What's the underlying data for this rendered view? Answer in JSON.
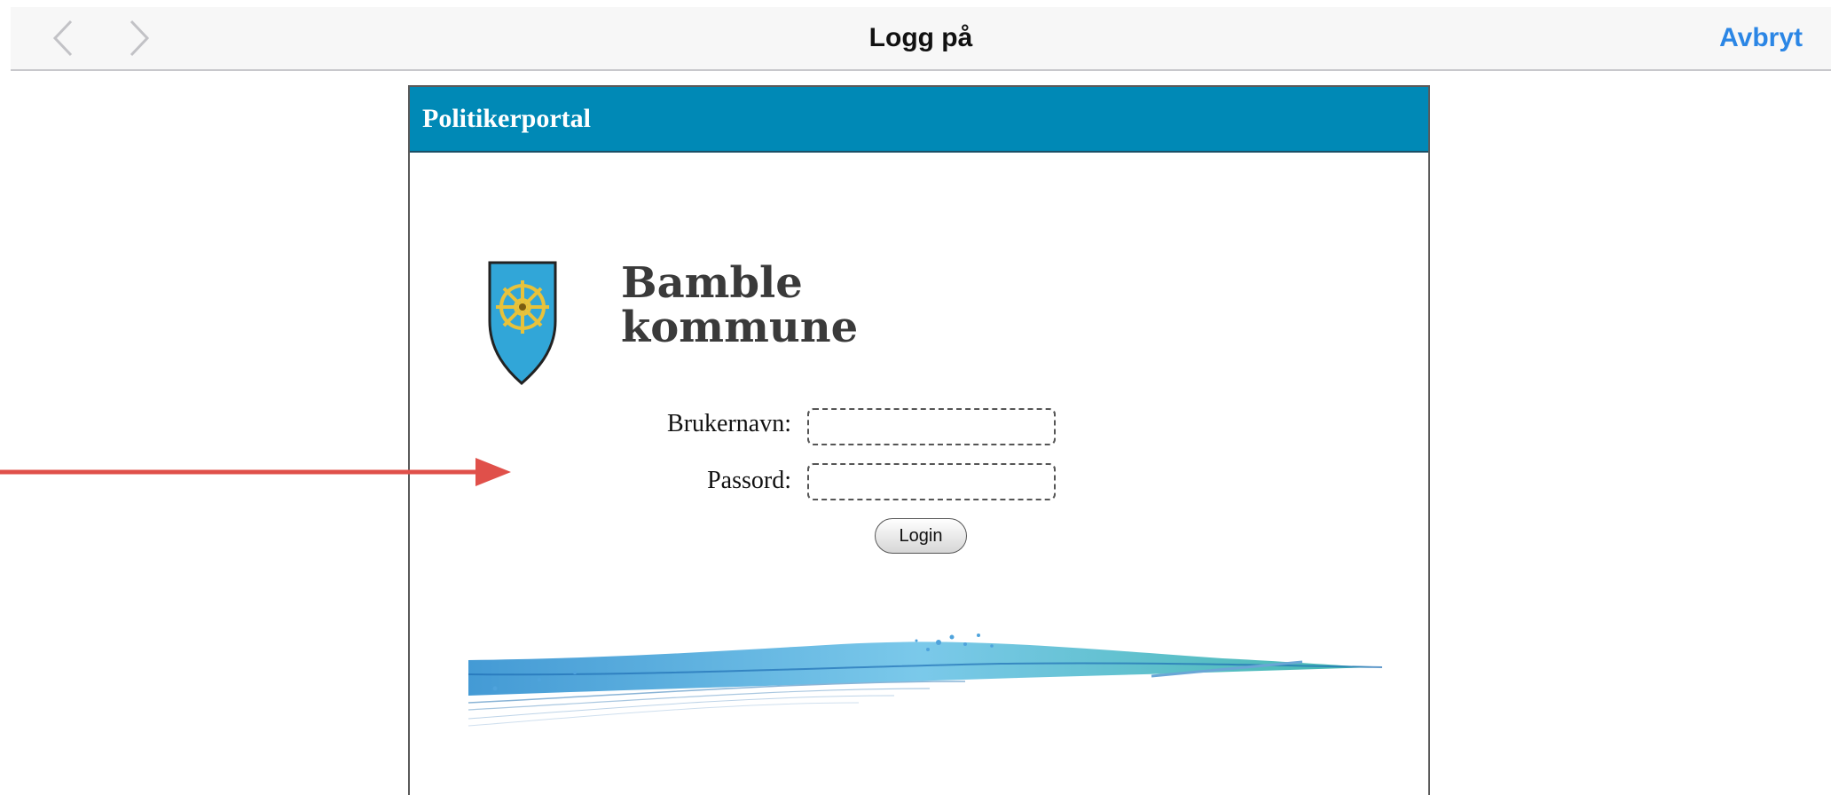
{
  "navbar": {
    "title": "Logg på",
    "cancel_label": "Avbryt",
    "back_icon": "chevron-left-icon",
    "forward_icon": "chevron-right-icon"
  },
  "portal": {
    "header_title": "Politikerportal",
    "brand_line1": "Bamble",
    "brand_line2": "kommune",
    "crest_icon": "ship-wheel-crest-icon",
    "accent_color": "#0089b6"
  },
  "form": {
    "username_label": "Brukernavn:",
    "username_value": "",
    "password_label": "Passord:",
    "password_value": "",
    "login_label": "Login"
  },
  "annotation": {
    "arrow_color": "#e0504a"
  }
}
